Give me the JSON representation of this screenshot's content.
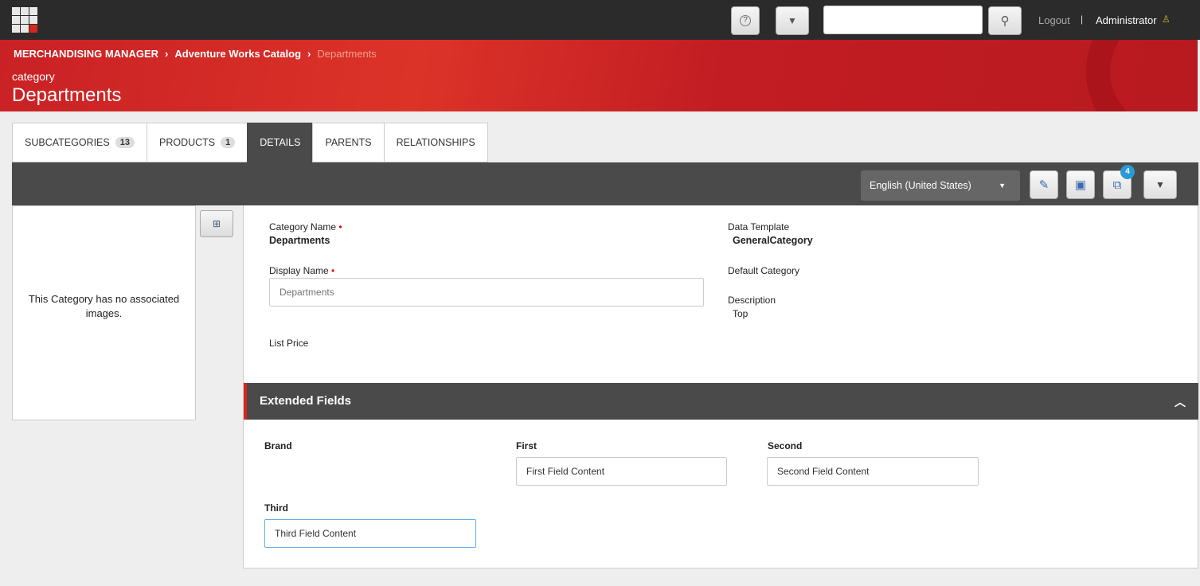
{
  "header": {
    "logout": "Logout",
    "separator": "|",
    "user": "Administrator"
  },
  "breadcrumb": [
    "MERCHANDISING MANAGER",
    "Adventure Works Catalog",
    "Departments"
  ],
  "page": {
    "subtitle": "category",
    "title": "Departments"
  },
  "tabs": [
    {
      "label": "SUBCATEGORIES",
      "count": "13"
    },
    {
      "label": "PRODUCTS",
      "count": "1"
    },
    {
      "label": "DETAILS",
      "active": true
    },
    {
      "label": "PARENTS"
    },
    {
      "label": "RELATIONSHIPS"
    }
  ],
  "toolbar": {
    "language": "English (United States)",
    "copy_badge": "4"
  },
  "images": {
    "empty": "This Category has no associated images."
  },
  "details": {
    "category_name_label": "Category Name",
    "category_name": "Departments",
    "display_name_label": "Display Name",
    "display_name_placeholder": "Departments",
    "list_price_label": "List Price",
    "data_template_label": "Data Template",
    "data_template": "GeneralCategory",
    "default_category_label": "Default Category",
    "description_label": "Description",
    "description": "Top"
  },
  "extended": {
    "title": "Extended Fields",
    "brand_label": "Brand",
    "first_label": "First",
    "first_value": "First Field Content",
    "second_label": "Second",
    "second_value": "Second Field Content",
    "third_label": "Third",
    "third_value": "Third Field Content"
  }
}
